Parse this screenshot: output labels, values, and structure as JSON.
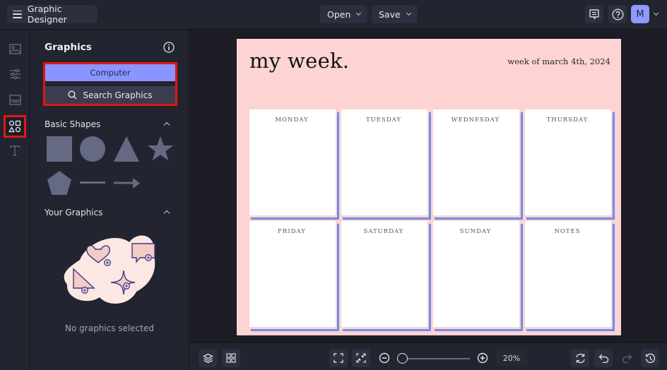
{
  "topbar": {
    "app_title": "Graphic Designer",
    "open_label": "Open",
    "save_label": "Save",
    "avatar_initial": "M",
    "icons": [
      "menu-icon",
      "comment-icon",
      "help-icon",
      "chevron-down-icon"
    ]
  },
  "rail": {
    "items": [
      {
        "name": "photos",
        "icon": "image-icon",
        "active": false
      },
      {
        "name": "adjust",
        "icon": "sliders-icon",
        "active": false
      },
      {
        "name": "layouts",
        "icon": "layout-icon",
        "active": false
      },
      {
        "name": "graphics",
        "icon": "shapes-icon",
        "active": true
      },
      {
        "name": "text",
        "icon": "text-icon",
        "active": false
      }
    ]
  },
  "panel": {
    "title": "Graphics",
    "computer_label": "Computer",
    "search_label": "Search Graphics",
    "basic_shapes_label": "Basic Shapes",
    "shapes": [
      "square",
      "circle",
      "triangle",
      "star",
      "pentagon",
      "line",
      "arrow"
    ],
    "your_graphics_label": "Your Graphics",
    "empty_text": "No graphics selected"
  },
  "canvas": {
    "title": "my week.",
    "subtitle": "week of march 4th, 2024",
    "days": [
      "MONDAY",
      "TUESDAY",
      "WEDNESDAY",
      "THURSDAY",
      "FRIDAY",
      "SATURDAY",
      "SUNDAY",
      "NOTES"
    ],
    "colors": {
      "background": "#fed3d3",
      "accent": "#6b8fe8"
    }
  },
  "bottombar": {
    "zoom_value": "20%",
    "zoom_fraction": 0.0
  }
}
